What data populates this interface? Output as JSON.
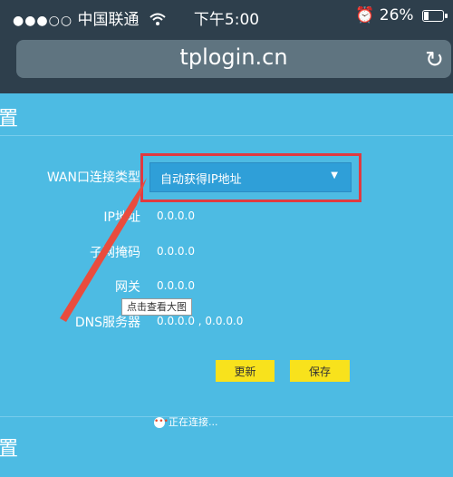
{
  "status_bar": {
    "signal_dots": "●●●○○",
    "carrier": "中国联通",
    "wifi_icon": "wifi-icon",
    "time": "下午5:00",
    "alarm_icon": "⏰",
    "battery_percent": "26%",
    "battery_level": 0.26
  },
  "browser": {
    "url": "tplogin.cn",
    "reload_icon": "↻"
  },
  "page": {
    "header_title": "置",
    "fields": {
      "wan_type_label": "WAN口连接类型",
      "wan_type_value": "自动获得IP地址",
      "ip_label": "IP地址",
      "ip_value": "0.0.0.0",
      "mask_label": "子网掩码",
      "mask_value": "0.0.0.0",
      "gateway_label": "网关",
      "gateway_value": "0.0.0.0",
      "dns_label": "DNS服务器",
      "dns_value": "0.0.0.0 , 0.0.0.0"
    },
    "tooltip": "点击查看大图",
    "buttons": {
      "refresh": "更新",
      "save": "保存"
    },
    "connecting_text": "正在连接...",
    "footer_title": "置"
  },
  "colors": {
    "background": "#4dbbe3",
    "top_bar": "#2e3f4c",
    "highlight": "#e03a40",
    "button": "#f8e21c"
  }
}
